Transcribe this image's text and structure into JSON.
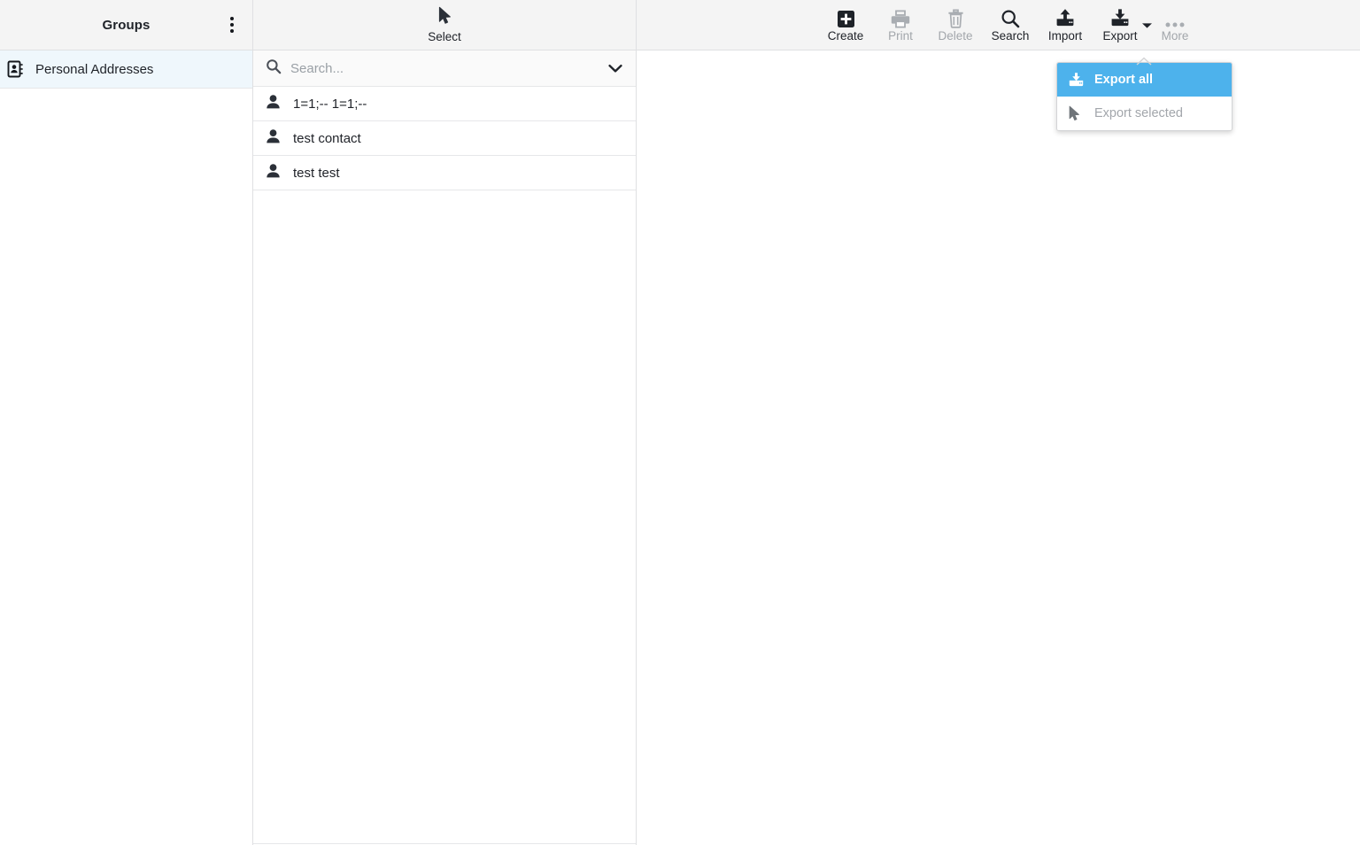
{
  "sidebar": {
    "header": {
      "title": "Groups",
      "menu_icon": "three-dots-vertical-icon"
    },
    "items": [
      {
        "label": "Personal Addresses",
        "icon": "address-book-icon",
        "selected": true
      }
    ]
  },
  "contact_list": {
    "header": {
      "label": "Select",
      "icon": "cursor-arrow-icon"
    },
    "search": {
      "value": "",
      "placeholder": "Search...",
      "icon": "search-icon",
      "dropdown_icon": "chevron-down-icon"
    },
    "contacts": [
      {
        "name": "1=1;-- 1=1;--",
        "icon": "person-icon"
      },
      {
        "name": "test contact",
        "icon": "person-icon"
      },
      {
        "name": "test test",
        "icon": "person-icon"
      }
    ]
  },
  "toolbar": {
    "items": [
      {
        "label": "Create",
        "icon": "plus-square-icon",
        "disabled": false
      },
      {
        "label": "Print",
        "icon": "printer-icon",
        "disabled": true
      },
      {
        "label": "Delete",
        "icon": "trash-icon",
        "disabled": true
      },
      {
        "label": "Search",
        "icon": "search-icon",
        "disabled": false
      },
      {
        "label": "Import",
        "icon": "upload-tray-icon",
        "disabled": false
      },
      {
        "label": "Export",
        "icon": "download-tray-icon",
        "disabled": false,
        "has_caret": true
      },
      {
        "label": "More",
        "icon": "three-dots-horizontal-icon",
        "disabled": true
      }
    ]
  },
  "export_menu": {
    "items": [
      {
        "label": "Export all",
        "icon": "download-tray-icon",
        "state": "highlighted"
      },
      {
        "label": "Export selected",
        "icon": "cursor-arrow-icon",
        "state": "disabled"
      }
    ]
  },
  "main": {
    "placeholder_art": "isometric-box-with-sphere-watermark"
  },
  "colors": {
    "accent_blue": "#4db2ec",
    "selected_row_blue": "#eff7fc",
    "header_grey": "#f4f4f4",
    "text_dark": "#21242a",
    "text_disabled": "#a2a6ab",
    "border": "#dfe0e2"
  }
}
